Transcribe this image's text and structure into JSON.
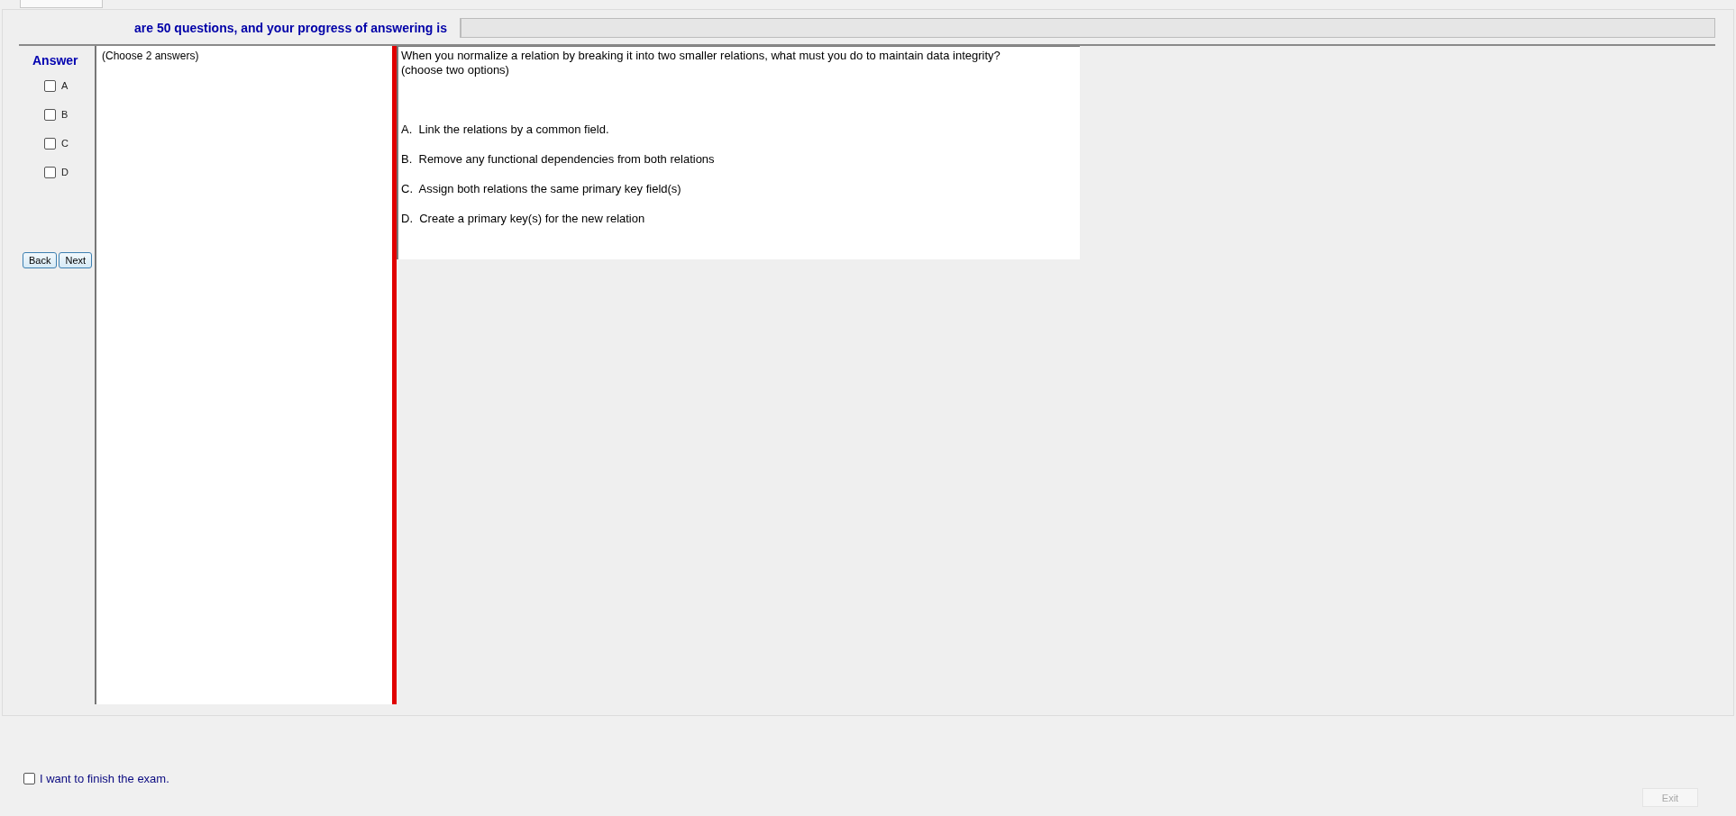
{
  "tabs": [
    {
      "selected": true
    }
  ],
  "header": {
    "text": "are 50 questions, and your progress of answering is",
    "progress": {
      "level": 0
    }
  },
  "answer_panel": {
    "title": "Answer",
    "options": [
      {
        "label": "A",
        "checked": false
      },
      {
        "label": "B",
        "checked": false
      },
      {
        "label": "C",
        "checked": false
      },
      {
        "label": "D",
        "checked": false
      }
    ],
    "buttons": [
      "Back",
      "Next"
    ]
  },
  "hint": "(Choose 2 answers)",
  "question": {
    "text": "When you normalize a relation by breaking it into two smaller relations, what must you do to maintain data integrity? (choose two options)",
    "choices": [
      "A.  Link the relations by a common field.",
      "B.  Remove any functional dependencies from both relations",
      "C.  Assign both relations the same primary key field(s)",
      "D.  Create a primary key(s) for the new relation"
    ]
  },
  "finish": {
    "label": "I want to finish the exam.",
    "checked": false
  },
  "exit_button": {
    "label": "Exit",
    "disabled": true
  }
}
